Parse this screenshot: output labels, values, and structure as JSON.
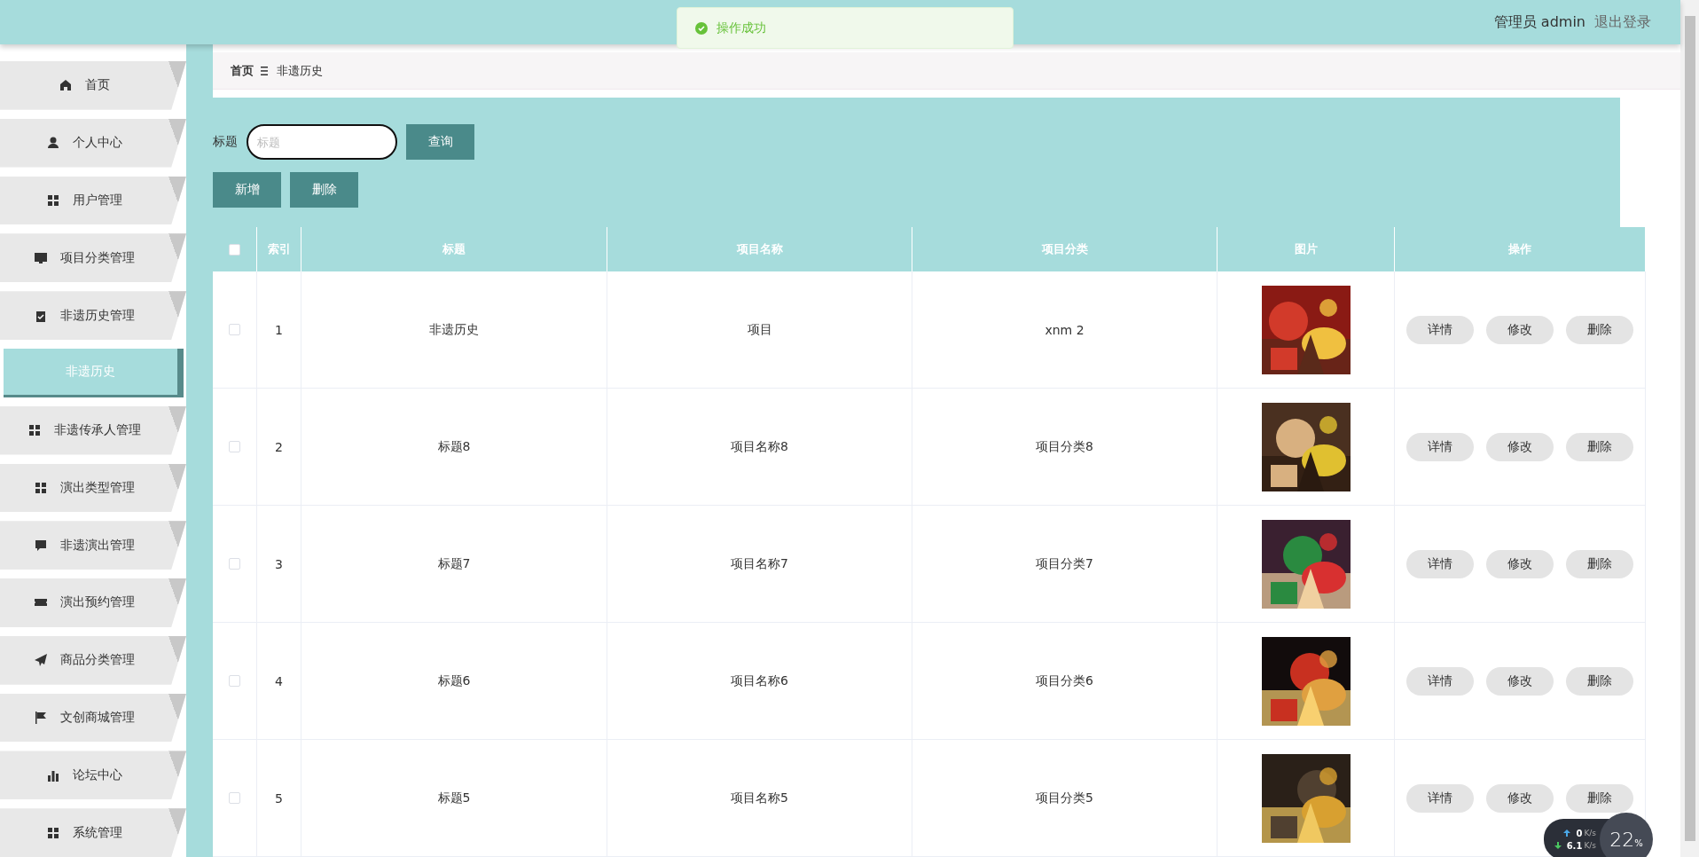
{
  "header": {
    "user": "管理员 admin",
    "logout": "退出登录"
  },
  "toast": {
    "text": "操作成功"
  },
  "sidebar": {
    "items": [
      {
        "label": "首页",
        "kind": "group",
        "selected": false
      },
      {
        "label": "个人中心",
        "kind": "group",
        "selected": false
      },
      {
        "label": "用户管理",
        "kind": "group",
        "selected": false
      },
      {
        "label": "项目分类管理",
        "kind": "group",
        "selected": false
      },
      {
        "label": "非遗历史管理",
        "kind": "group",
        "selected": false
      },
      {
        "label": "非遗历史",
        "kind": "sub",
        "selected": true
      },
      {
        "label": "非遗传承人管理",
        "kind": "group",
        "selected": false
      },
      {
        "label": "演出类型管理",
        "kind": "group",
        "selected": false
      },
      {
        "label": "非遗演出管理",
        "kind": "group",
        "selected": false
      },
      {
        "label": "演出预约管理",
        "kind": "group",
        "selected": false
      },
      {
        "label": "商品分类管理",
        "kind": "group",
        "selected": false
      },
      {
        "label": "文创商城管理",
        "kind": "group",
        "selected": false
      },
      {
        "label": "论坛中心",
        "kind": "group",
        "selected": false
      },
      {
        "label": "系统管理",
        "kind": "group",
        "selected": false
      }
    ]
  },
  "breadcrumb": [
    "首页",
    "非遗历史"
  ],
  "search": {
    "label": "标题",
    "placeholder": "标题",
    "button": "查询"
  },
  "toolbar": [
    "新增",
    "删除"
  ],
  "table": {
    "select_all_checked": false,
    "columns": [
      "索引",
      "标题",
      "项目名称",
      "项目分类",
      "图片",
      "操作"
    ],
    "rows": [
      {
        "checked": false,
        "index": "1",
        "title": "非遗历史",
        "name": "项目",
        "category": "xnm 2",
        "actions": [
          "详情",
          "修改",
          "删除"
        ]
      },
      {
        "checked": false,
        "index": "2",
        "title": "标题8",
        "name": "项目名称8",
        "category": "项目分类8",
        "actions": [
          "详情",
          "修改",
          "删除"
        ]
      },
      {
        "checked": false,
        "index": "3",
        "title": "标题7",
        "name": "项目名称7",
        "category": "项目分类7",
        "actions": [
          "详情",
          "修改",
          "删除"
        ]
      },
      {
        "checked": false,
        "index": "4",
        "title": "标题6",
        "name": "项目名称6",
        "category": "项目分类6",
        "actions": [
          "详情",
          "修改",
          "删除"
        ]
      },
      {
        "checked": false,
        "index": "5",
        "title": "标题5",
        "name": "项目名称5",
        "category": "项目分类5",
        "actions": [
          "详情",
          "修改",
          "删除"
        ]
      }
    ]
  },
  "net_widget": {
    "up": "0",
    "up_unit": "K/s",
    "down": "6.1",
    "down_unit": "K/s",
    "cpu": "22",
    "cpu_unit": "%"
  }
}
